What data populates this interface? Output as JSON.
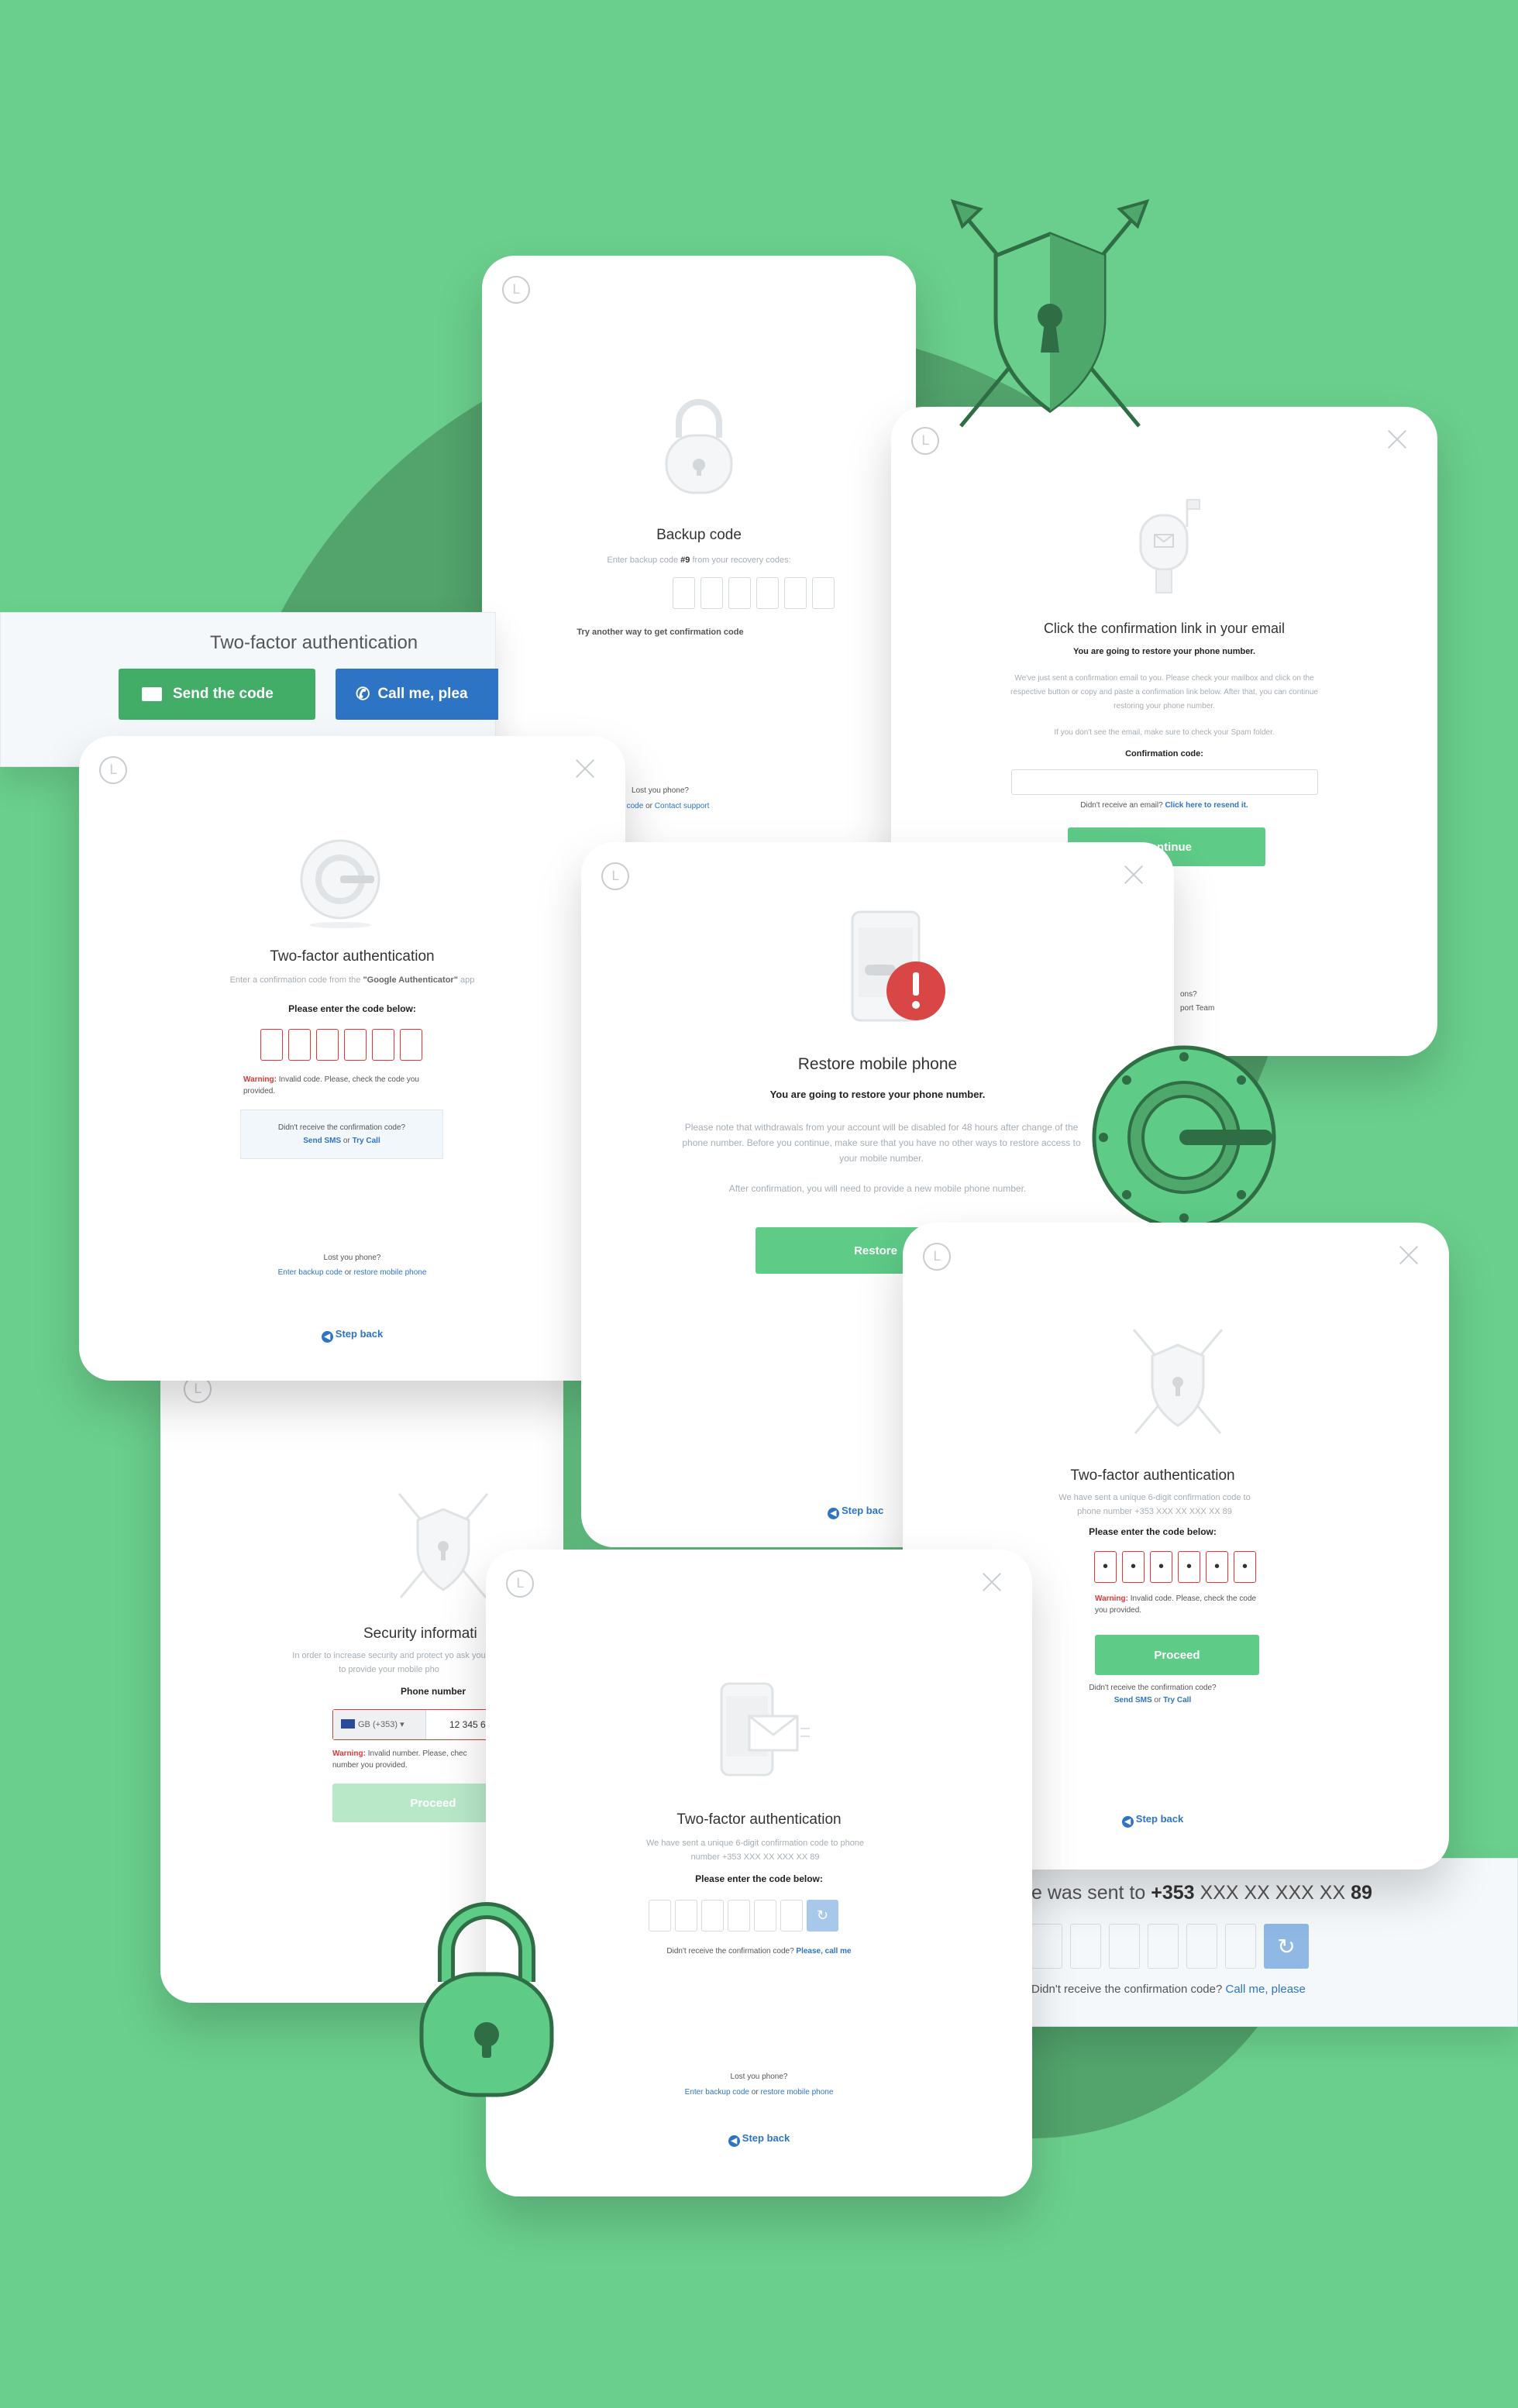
{
  "colors": {
    "background": "#6acf8c",
    "circle": "#52a36c",
    "accent_green": "#5ecb87",
    "link_blue": "#2e74c4",
    "error_red": "#d83a3a"
  },
  "logo_glyph": "L",
  "backup": {
    "title": "Backup code",
    "instruction_pre": "Enter backup code",
    "instruction_num": "#9",
    "instruction_post": "from your recovery codes:",
    "try_link": "Try another way to get confirmation code",
    "lost_phone": "Lost you phone?",
    "link_2fa": "2FA code",
    "or": "or",
    "link_support": "Contact support"
  },
  "email": {
    "title": "Click the confirmation link in your email",
    "bold": "You are going to restore your phone number.",
    "para1": "We've just sent a confirmation email to you. Please check your mailbox and click on the respective button or copy and paste a confirmation link below. After that, you can continue restoring your phone number.",
    "para2": "If you don't see the email, make sure to check your Spam folder.",
    "label": "Confirmation code:",
    "didnt": "Didn't receive an email?",
    "resend": "Click here to resend it.",
    "button": "Continue",
    "questions": "ons?",
    "team": "port Team"
  },
  "strip": {
    "title": "Two-factor authentication",
    "send_button": "Send the code",
    "call_button": "Call me, plea"
  },
  "google": {
    "title": "Two-factor authentication",
    "sub_pre": "Enter a confirmation code from the",
    "sub_app": "\"Google Authenticator\"",
    "sub_post": "app",
    "label": "Please enter the code below:",
    "warn_label": "Warning:",
    "warn_text": "Invalid code. Please, check the code you provided.",
    "didnt": "Didn't receive the confirmation code?",
    "send_sms": "Send SMS",
    "or": "or",
    "try_call": "Try Call",
    "lost": "Lost you phone?",
    "backup": "Enter backup code",
    "restore": "restore mobile phone",
    "step_back": "Step back"
  },
  "restore": {
    "title": "Restore mobile phone",
    "bold": "You are going to restore your phone number.",
    "para1": "Please note that withdrawals from your account will be disabled for 48 hours after change of the phone number. Before you continue, make sure that you have no other ways to restore access to your mobile number.",
    "para2": "After confirmation, you will need to provide a new mobile phone number.",
    "button": "Restore",
    "step_back": "Step bac"
  },
  "security": {
    "title": "Security informati",
    "sub": "In order to increase security and protect yo ask you to provide your mobile pho",
    "label": "Phone number",
    "country": "GB (+353)",
    "phone_value": "12 345 6",
    "warn_label": "Warning:",
    "warn_text": "Invalid number. Please, chec number you provided.",
    "button": "Proceed"
  },
  "sms": {
    "title": "Two-factor authentication",
    "sub": "We have sent a unique 6-digit confirmation code to phone number +353 XXX XX XXX XX 89",
    "label": "Please enter the code below:",
    "didnt": "Didn't receive the confirmation code?",
    "call": "Please, call me",
    "lost": "Lost you phone?",
    "backup": "Enter backup code",
    "or": "or",
    "restore": "restore mobile phone",
    "step_back": "Step back"
  },
  "phone2fa": {
    "title": "Two-factor authentication",
    "sub": "We have sent a unique 6-digit confirmation code to phone number +353 XXX XX XXX XX 89",
    "label": "Please enter the code below:",
    "warn_label": "Warning:",
    "warn_text": "Invalid code. Please, check the code you provided.",
    "button": "Proceed",
    "didnt": "Didn't receive the confirmation code?",
    "send_sms": "Send SMS",
    "or": "or",
    "try_call": "Try Call",
    "step_back": "Step back"
  },
  "strip2": {
    "text_pre": "e was sent to",
    "text_num": "+353",
    "text_mid": "XXX XX XXX XX",
    "text_end": "89",
    "didnt": "Didn't receive the confirmation code?",
    "call": "Call me, please"
  },
  "icons": [
    "shield-arrows-icon",
    "lock-icon",
    "authenticator-icon",
    "mailbox-icon",
    "phone-alert-icon",
    "phone-mail-icon",
    "refresh-icon",
    "envelope-icon",
    "phone-icon",
    "flag-gb-icon"
  ]
}
